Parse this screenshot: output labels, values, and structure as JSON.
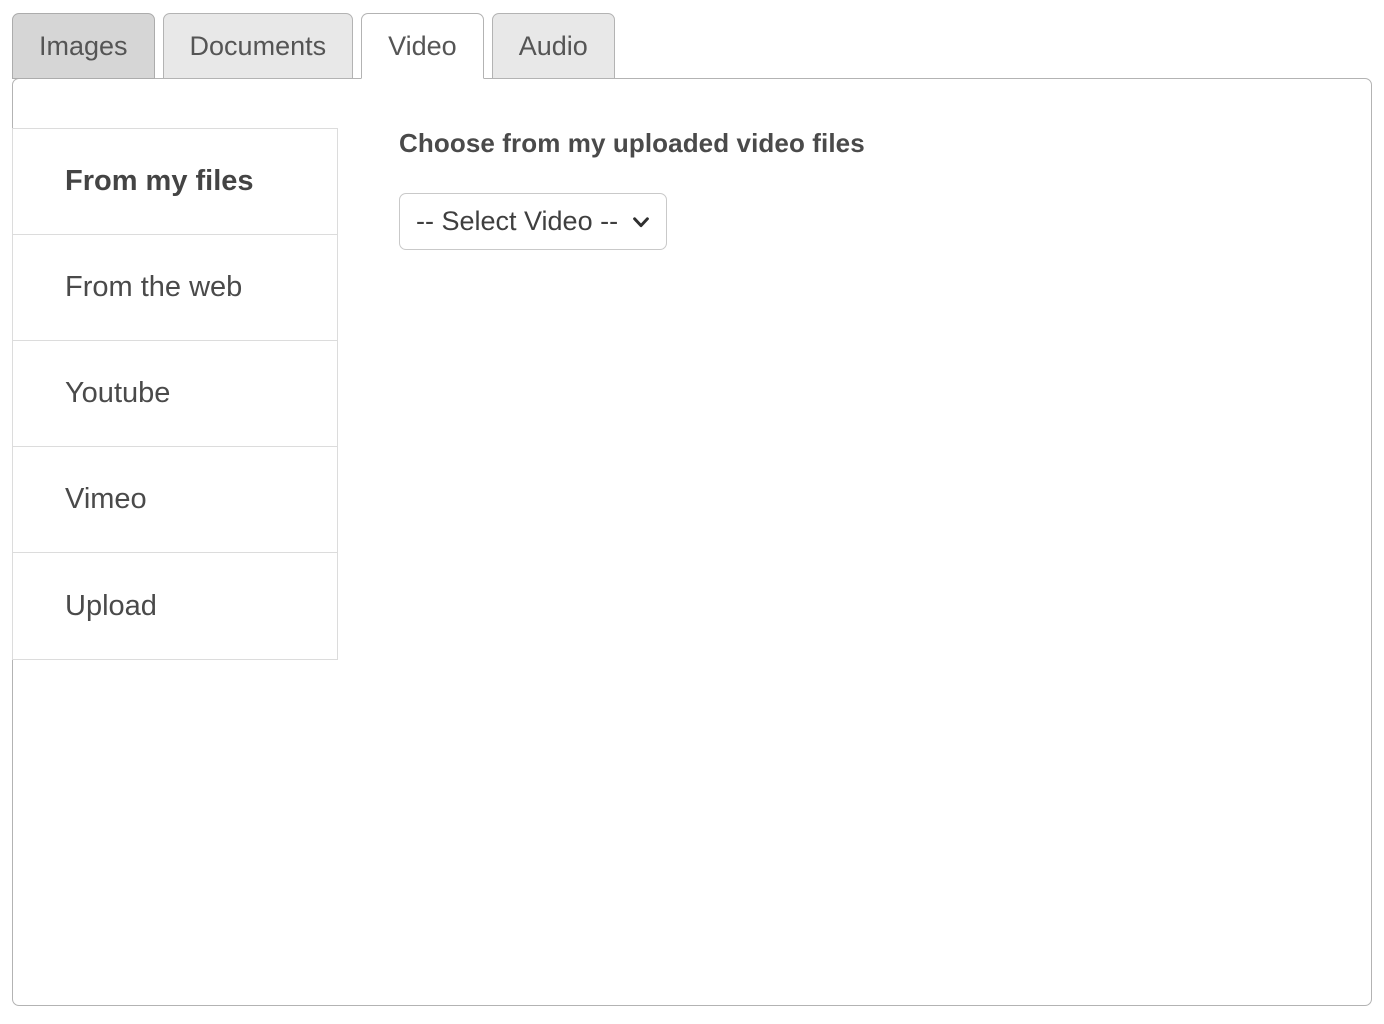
{
  "tabs": [
    {
      "label": "Images",
      "state": "hovered"
    },
    {
      "label": "Documents",
      "state": "default"
    },
    {
      "label": "Video",
      "state": "active"
    },
    {
      "label": "Audio",
      "state": "default"
    }
  ],
  "sidebar": {
    "items": [
      {
        "label": "From my files",
        "active": true
      },
      {
        "label": "From the web",
        "active": false
      },
      {
        "label": "Youtube",
        "active": false
      },
      {
        "label": "Vimeo",
        "active": false
      },
      {
        "label": "Upload",
        "active": false
      }
    ]
  },
  "content": {
    "title": "Choose from my uploaded video files",
    "select": {
      "value": "-- Select Video --",
      "options": [
        "-- Select Video --"
      ],
      "arrow_icon": "chevron-down-icon"
    }
  },
  "colors": {
    "text": "#444444",
    "panel_border": "#b3b3b3",
    "divider": "#dcdcdc",
    "tab_default_bg": "#e8e8e8",
    "tab_hover_bg": "#d6d6d6",
    "tab_active_bg": "#ffffff"
  }
}
